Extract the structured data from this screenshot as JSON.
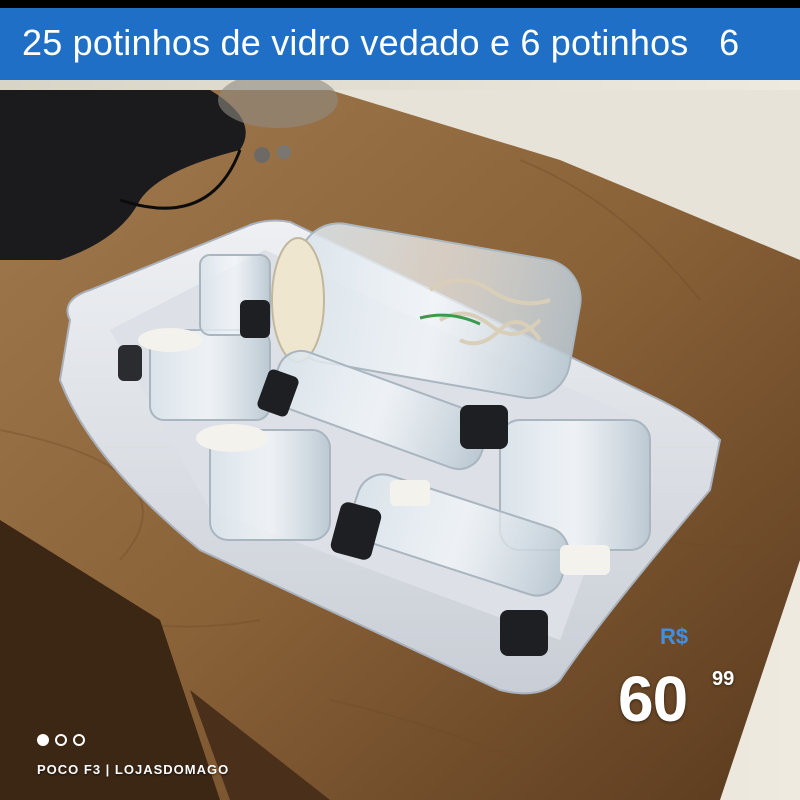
{
  "listing": {
    "title": "25 potinhos de vidro vedado e 6 potinhos   6"
  },
  "price": {
    "currency": "R$",
    "integer": "60",
    "cents": "99"
  },
  "carousel": {
    "dots": [
      "active",
      "inactive",
      "inactive"
    ]
  },
  "photo": {
    "watermark": "POCO F3 | LOJASDOMAGO",
    "description_icon": "product-photo"
  },
  "colors": {
    "banner": "#1f6fc6",
    "currency": "#3f8fe6"
  }
}
